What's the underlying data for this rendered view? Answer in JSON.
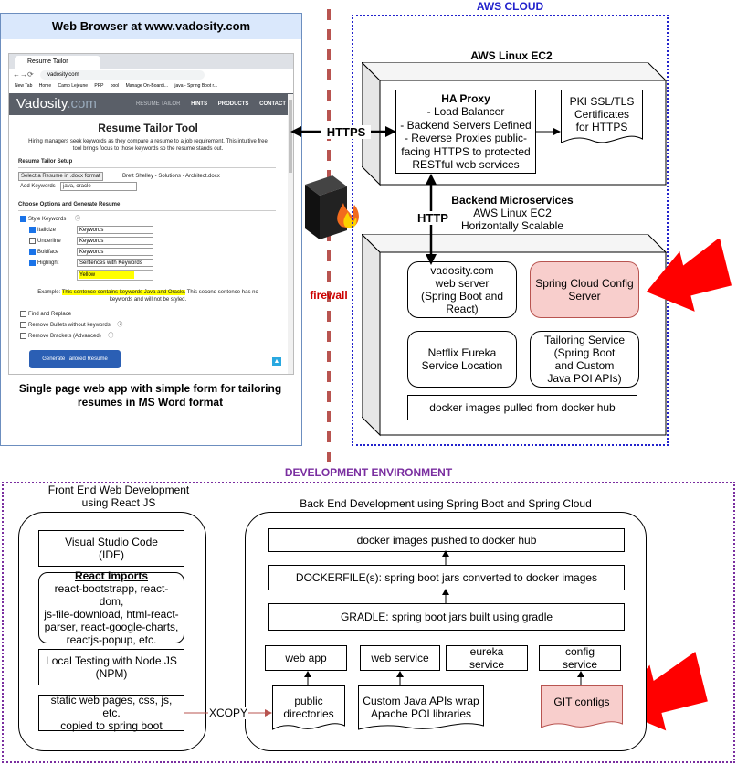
{
  "browser": {
    "title": "Web Browser at www.vadosity.com",
    "tab_label": "Resume Tailor",
    "url": "vadosity.com",
    "bookmarks": [
      "New Tab",
      "Home",
      "Camp Lejeune",
      "PPP",
      "pool",
      "Manage On-Boardi...",
      "java - Spring Boot r..."
    ],
    "logo": "Vadosity",
    "logo_suffix": ".com",
    "nav": [
      "RESUME TAILOR",
      "HINTS",
      "PRODUCTS",
      "CONTACT"
    ],
    "page_heading": "Resume Tailor Tool",
    "intro_line1": "Hiring managers seek keywords as they compare a resume to a job requirement. This intuitive free",
    "intro_line2": "tool brings focus to those keywords so the resume stands out.",
    "setup_heading": "Resume Tailor Setup",
    "select_button": "Select a Resume in .docx format",
    "selected_file": "Brett Shelley - Solutions - Architect.docx",
    "add_keywords_label": "Add Keywords",
    "add_keywords_value": "java, oracle",
    "options_heading": "Choose Options and Generate Resume",
    "style_keywords": "Style Keywords",
    "options": [
      {
        "label": "Italicize",
        "value": "Keywords"
      },
      {
        "label": "Underline",
        "value": "Keywords"
      },
      {
        "label": "Boldface",
        "value": "Keywords"
      },
      {
        "label": "Highlight",
        "value": "Sentences with Keywords"
      }
    ],
    "highlight_color": "Yellow",
    "example_label": "Example:",
    "example_highlight": "This sentence contains keywords Java and Oracle.",
    "example_rest": "This second sentence has no",
    "example_line2": "keywords and will not be styled.",
    "find_replace": "Find and Replace",
    "remove_bullets": "Remove Bullets without keywords",
    "remove_brackets": "Remove Brackets (Advanced)",
    "generate_button": "Generate Tailored Resume",
    "caption_line1": "Single page web app with simple form for tailoring",
    "caption_line2": "resumes in MS Word format"
  },
  "connectors": {
    "https": "HTTPS",
    "http": "HTTP",
    "firewall": "firewall",
    "xcopy": "XCOPY"
  },
  "aws": {
    "region_title": "AWS CLOUD",
    "ec2_title": "AWS Linux EC2",
    "haproxy": {
      "title": "HA Proxy",
      "lines": [
        "- Load Balancer",
        "- Backend Servers Defined",
        "- Reverse Proxies public-",
        "facing HTTPS to protected",
        "RESTful web services"
      ]
    },
    "pki": [
      "PKI SSL/TLS",
      "Certificates",
      "for HTTPS"
    ],
    "backend_title": "Backend Microservices",
    "backend_sub1": "AWS Linux EC2",
    "backend_sub2": "Horizontally Scalable",
    "vadosity_server": [
      "vadosity.com",
      "web server",
      "(Spring Boot and",
      "React)"
    ],
    "config_server": [
      "Spring Cloud Config",
      "Server"
    ],
    "eureka": [
      "Netflix Eureka",
      "Service Location"
    ],
    "tailoring": [
      "Tailoring Service",
      "(Spring Boot",
      "and Custom",
      "Java POI APIs)"
    ],
    "docker_pulled": "docker images pulled from docker hub"
  },
  "dev": {
    "region_title": "DEVELOPMENT ENVIRONMENT",
    "frontend_title": [
      "Front End Web Development",
      "using React JS"
    ],
    "vscode": [
      "Visual Studio Code",
      "(IDE)"
    ],
    "react_imports_title": "React Imports",
    "react_imports": [
      "react-bootstrapp, react-dom,",
      "js-file-download, html-react-",
      "parser, react-google-charts,",
      "reactjs-popup, etc."
    ],
    "node": [
      "Local Testing with Node.JS",
      "(NPM)"
    ],
    "static": [
      "static web pages, css, js, etc.",
      "copied to spring boot"
    ],
    "backend_title": "Back End Development using Spring Boot and Spring Cloud",
    "docker_pushed": "docker images pushed to docker hub",
    "dockerfile": "DOCKERFILE(s): spring boot jars converted to docker images",
    "gradle": "GRADLE: spring boot jars built using gradle",
    "web_app": "web app",
    "web_service": "web service",
    "eureka_service": [
      "eureka",
      "service"
    ],
    "config_service": [
      "config",
      "service"
    ],
    "public_dirs": [
      "public",
      "directories"
    ],
    "custom_java": [
      "Custom Java APIs wrap",
      "Apache POI libraries"
    ],
    "git_configs": "GIT configs"
  },
  "colors": {
    "highlight_fill": "#f8cecc",
    "highlight_stroke": "#b85450",
    "callout_arrow": "#ff0000",
    "firewall_line": "#b85450",
    "aws_border": "#2222cc",
    "dev_border": "#7a2ea0",
    "xcopy_line": "#b85450",
    "browser_panel": "#dae8fc"
  },
  "icons": [
    "firewall-icon",
    "callout-arrow-icon"
  ]
}
